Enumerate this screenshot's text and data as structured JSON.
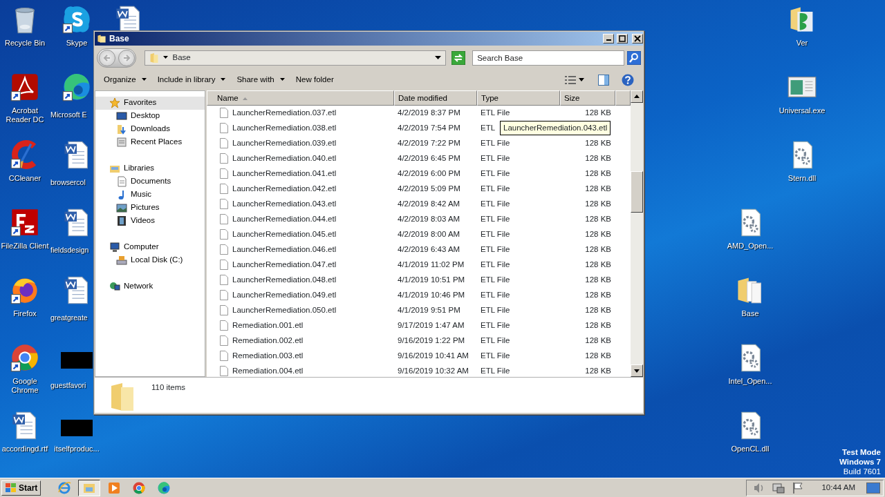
{
  "desktop_icons": [
    {
      "label": "Recycle Bin",
      "kind": "recycle",
      "shortcut": false
    },
    {
      "label": "Skype",
      "kind": "skype",
      "shortcut": true
    },
    {
      "kind": "word",
      "shortcut": false
    },
    {
      "label": "Acrobat Reader DC",
      "kind": "acrobat",
      "shortcut": true
    },
    {
      "label": "Microsoft E",
      "kind": "edge",
      "shortcut": true
    },
    {
      "label": "CCleaner",
      "kind": "ccleaner",
      "shortcut": true
    },
    {
      "label": "browsercol",
      "kind": "word",
      "shortcut": false
    },
    {
      "label": "FileZilla Client",
      "kind": "filezilla",
      "shortcut": true
    },
    {
      "label": "fieldsdesign",
      "kind": "word",
      "shortcut": false
    },
    {
      "label": "Firefox",
      "kind": "firefox",
      "shortcut": true
    },
    {
      "label": "greatgreate",
      "kind": "word",
      "shortcut": false
    },
    {
      "label": "Google Chrome",
      "kind": "chrome",
      "shortcut": true
    },
    {
      "label": "guestfavori",
      "kind": "redacted",
      "shortcut": false
    },
    {
      "label": "accordingd.rtf",
      "kind": "word",
      "shortcut": false
    },
    {
      "label": "itselfproduc...",
      "kind": "redacted",
      "shortcut": false
    },
    {
      "label": "Ver",
      "kind": "greenfolder",
      "shortcut": false
    },
    {
      "label": "Universal.exe",
      "kind": "app",
      "shortcut": false
    },
    {
      "label": "Stern.dll",
      "kind": "gearfile",
      "shortcut": false
    },
    {
      "label": "AMD_Open...",
      "kind": "gearfile",
      "shortcut": false
    },
    {
      "label": "Base",
      "kind": "folder",
      "shortcut": false
    },
    {
      "label": "Intel_Open...",
      "kind": "gearfile",
      "shortcut": false
    },
    {
      "label": "OpenCL.dll",
      "kind": "gearfile",
      "shortcut": false
    }
  ],
  "window": {
    "title": "Base",
    "address": "Base",
    "search": {
      "placeholder": "Search Base"
    },
    "toolbar": [
      {
        "label": "Organize",
        "menu": true
      },
      {
        "label": "Include in library",
        "menu": true
      },
      {
        "label": "Share with",
        "menu": true
      },
      {
        "label": "New folder",
        "menu": false
      }
    ],
    "nav": [
      {
        "label": "Favorites",
        "kind": "star",
        "selected": true,
        "children": [
          {
            "label": "Desktop",
            "kind": "desktop",
            "selected": false
          },
          {
            "label": "Downloads",
            "kind": "downloads",
            "selected": false
          },
          {
            "label": "Recent Places",
            "kind": "recent",
            "selected": false
          }
        ]
      },
      {
        "label": "Libraries",
        "kind": "libraries",
        "selected": false,
        "children": [
          {
            "label": "Documents",
            "kind": "documents",
            "selected": false
          },
          {
            "label": "Music",
            "kind": "music",
            "selected": false
          },
          {
            "label": "Pictures",
            "kind": "pictures",
            "selected": false
          },
          {
            "label": "Videos",
            "kind": "videos",
            "selected": false
          }
        ]
      },
      {
        "label": "Computer",
        "kind": "computer",
        "selected": false,
        "children": [
          {
            "label": "Local Disk (C:)",
            "kind": "disk",
            "selected": false
          }
        ]
      },
      {
        "label": "Network",
        "kind": "network",
        "selected": false
      }
    ],
    "columns": [
      {
        "label": "Name",
        "sorted": true
      },
      {
        "label": "Date modified",
        "sorted": false
      },
      {
        "label": "Type",
        "sorted": false
      },
      {
        "label": "Size",
        "sorted": false
      }
    ],
    "rows": [
      {
        "name": "LauncherRemediation.037.etl",
        "date": "4/2/2019 8:37 PM",
        "type": "ETL File",
        "size": "128 KB"
      },
      {
        "name": "LauncherRemediation.038.etl",
        "date": "4/2/2019 7:54 PM",
        "type": "ETL"
      },
      {
        "name": "LauncherRemediation.039.etl",
        "date": "4/2/2019 7:22 PM",
        "type": "ETL File",
        "size": "128 KB"
      },
      {
        "name": "LauncherRemediation.040.etl",
        "date": "4/2/2019 6:45 PM",
        "type": "ETL File",
        "size": "128 KB"
      },
      {
        "name": "LauncherRemediation.041.etl",
        "date": "4/2/2019 6:00 PM",
        "type": "ETL File",
        "size": "128 KB"
      },
      {
        "name": "LauncherRemediation.042.etl",
        "date": "4/2/2019 5:09 PM",
        "type": "ETL File",
        "size": "128 KB"
      },
      {
        "name": "LauncherRemediation.043.etl",
        "date": "4/2/2019 8:42 AM",
        "type": "ETL File",
        "size": "128 KB"
      },
      {
        "name": "LauncherRemediation.044.etl",
        "date": "4/2/2019 8:03 AM",
        "type": "ETL File",
        "size": "128 KB"
      },
      {
        "name": "LauncherRemediation.045.etl",
        "date": "4/2/2019 8:00 AM",
        "type": "ETL File",
        "size": "128 KB"
      },
      {
        "name": "LauncherRemediation.046.etl",
        "date": "4/2/2019 6:43 AM",
        "type": "ETL File",
        "size": "128 KB"
      },
      {
        "name": "LauncherRemediation.047.etl",
        "date": "4/1/2019 11:02 PM",
        "type": "ETL File",
        "size": "128 KB"
      },
      {
        "name": "LauncherRemediation.048.etl",
        "date": "4/1/2019 10:51 PM",
        "type": "ETL File",
        "size": "128 KB"
      },
      {
        "name": "LauncherRemediation.049.etl",
        "date": "4/1/2019 10:46 PM",
        "type": "ETL File",
        "size": "128 KB"
      },
      {
        "name": "LauncherRemediation.050.etl",
        "date": "4/1/2019 9:51 PM",
        "type": "ETL File",
        "size": "128 KB"
      },
      {
        "name": "Remediation.001.etl",
        "date": "9/17/2019 1:47 AM",
        "type": "ETL File",
        "size": "128 KB"
      },
      {
        "name": "Remediation.002.etl",
        "date": "9/16/2019 1:22 PM",
        "type": "ETL File",
        "size": "128 KB"
      },
      {
        "name": "Remediation.003.etl",
        "date": "9/16/2019 10:41 AM",
        "type": "ETL File",
        "size": "128 KB"
      },
      {
        "name": "Remediation.004.etl",
        "date": "9/16/2019 10:32 AM",
        "type": "ETL File",
        "size": "128 KB"
      }
    ],
    "tooltip": "LauncherRemediation.043.etl",
    "status": "110 items"
  },
  "desktop_notice": [
    {
      "text": "Test Mode",
      "bold": true
    },
    {
      "text": "Windows 7",
      "bold": true
    },
    {
      "text": "Build 7601",
      "bold": false
    }
  ],
  "taskbar": {
    "start": "Start",
    "apps": [
      {
        "kind": "ie",
        "active": false
      },
      {
        "kind": "explorer",
        "active": true
      },
      {
        "kind": "media",
        "active": false
      },
      {
        "kind": "chrome",
        "active": false
      },
      {
        "kind": "edge",
        "active": false
      }
    ],
    "tray": [
      {
        "kind": "speaker"
      },
      {
        "kind": "network"
      },
      {
        "kind": "flag"
      }
    ],
    "clock": "10:44 AM"
  }
}
